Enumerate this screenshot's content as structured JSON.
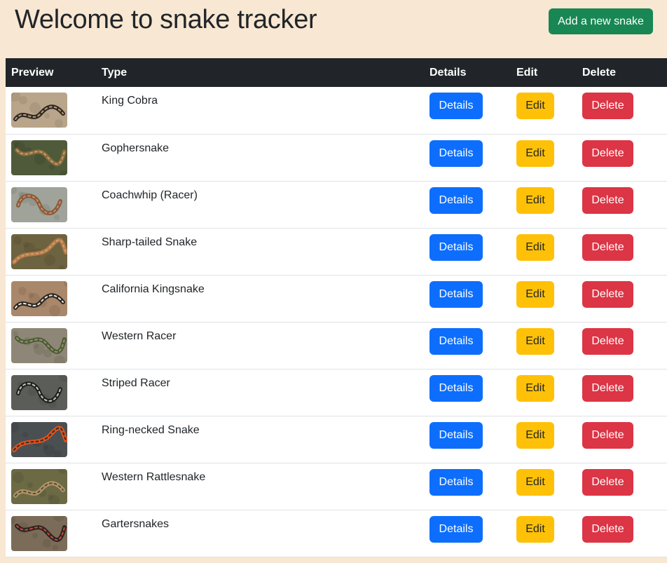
{
  "header": {
    "title": "Welcome to snake tracker",
    "add_button_label": "Add a new snake"
  },
  "table": {
    "columns": [
      "Preview",
      "Type",
      "Details",
      "Edit",
      "Delete"
    ],
    "rows": [
      {
        "type": "King Cobra",
        "details_label": "Details",
        "edit_label": "Edit",
        "delete_label": "Delete",
        "thumb": {
          "bg": "#b9a58a",
          "snake": "#2a2a28",
          "accent": "#c99a6b"
        }
      },
      {
        "type": "Gophersnake",
        "details_label": "Details",
        "edit_label": "Edit",
        "delete_label": "Delete",
        "thumb": {
          "bg": "#4e5a3a",
          "snake": "#8a6a3e",
          "accent": "#c4a06a"
        }
      },
      {
        "type": "Coachwhip (Racer)",
        "details_label": "Details",
        "edit_label": "Edit",
        "delete_label": "Delete",
        "thumb": {
          "bg": "#9fa39a",
          "snake": "#8a5a3a",
          "accent": "#c58f68"
        }
      },
      {
        "type": "Sharp-tailed Snake",
        "details_label": "Details",
        "edit_label": "Edit",
        "delete_label": "Delete",
        "thumb": {
          "bg": "#6e6340",
          "snake": "#b37a4a",
          "accent": "#d79f6a"
        }
      },
      {
        "type": "California Kingsnake",
        "details_label": "Details",
        "edit_label": "Edit",
        "delete_label": "Delete",
        "thumb": {
          "bg": "#a9876a",
          "snake": "#2d2824",
          "accent": "#efe6d6"
        }
      },
      {
        "type": "Western Racer",
        "details_label": "Details",
        "edit_label": "Edit",
        "delete_label": "Delete",
        "thumb": {
          "bg": "#8e8777",
          "snake": "#4f5a38",
          "accent": "#8d9a68"
        }
      },
      {
        "type": "Striped Racer",
        "details_label": "Details",
        "edit_label": "Edit",
        "delete_label": "Delete",
        "thumb": {
          "bg": "#5b5e58",
          "snake": "#1f2220",
          "accent": "#c9c9bd"
        }
      },
      {
        "type": "Ring-necked Snake",
        "details_label": "Details",
        "edit_label": "Edit",
        "delete_label": "Delete",
        "thumb": {
          "bg": "#4a4f52",
          "snake": "#e0521c",
          "accent": "#2a2c2e"
        }
      },
      {
        "type": "Western Rattlesnake",
        "details_label": "Details",
        "edit_label": "Edit",
        "delete_label": "Delete",
        "thumb": {
          "bg": "#6b6a45",
          "snake": "#b09468",
          "accent": "#5b4a32"
        }
      },
      {
        "type": "Gartersnakes",
        "details_label": "Details",
        "edit_label": "Edit",
        "delete_label": "Delete",
        "thumb": {
          "bg": "#7a6c58",
          "snake": "#2c2522",
          "accent": "#c84a3a"
        }
      }
    ]
  },
  "colors": {
    "page_bg": "#f8e7d2",
    "header_bg": "#212529",
    "success": "#198754",
    "primary": "#0d6efd",
    "warning": "#ffc107",
    "danger": "#dc3545"
  }
}
